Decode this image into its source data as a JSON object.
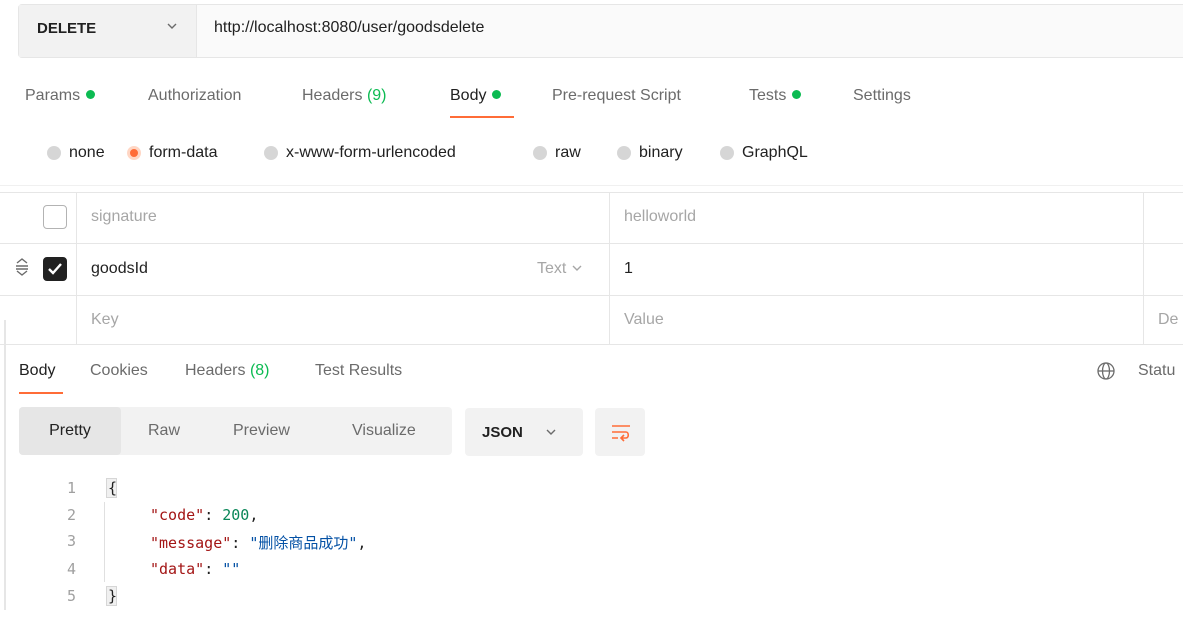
{
  "request": {
    "method": "DELETE",
    "url": "http://localhost:8080/user/goodsdelete"
  },
  "request_tabs": {
    "params": "Params",
    "authorization": "Authorization",
    "headers": "Headers",
    "headers_count": "(9)",
    "body": "Body",
    "pre_request_script": "Pre-request Script",
    "tests": "Tests",
    "settings": "Settings"
  },
  "body_types": {
    "none": "none",
    "form_data": "form-data",
    "urlencoded": "x-www-form-urlencoded",
    "raw": "raw",
    "binary": "binary",
    "graphql": "GraphQL",
    "selected": "form-data"
  },
  "params_rows": [
    {
      "key": "signature",
      "value": "helloworld",
      "checked": false
    },
    {
      "key": "goodsId",
      "type": "Text",
      "value": "1",
      "checked": true
    }
  ],
  "params_placeholders": {
    "key": "Key",
    "value": "Value",
    "description": "De"
  },
  "response_tabs": {
    "body": "Body",
    "cookies": "Cookies",
    "headers": "Headers",
    "headers_count": "(8)",
    "test_results": "Test Results",
    "status": "Statu"
  },
  "format_bar": {
    "pretty": "Pretty",
    "raw": "Raw",
    "preview": "Preview",
    "visualize": "Visualize",
    "language": "JSON"
  },
  "response_body": {
    "line_numbers": [
      "1",
      "2",
      "3",
      "4",
      "5"
    ],
    "open_brace": "{",
    "close_brace": "}",
    "code_key": "\"code\"",
    "code_value": "200",
    "message_key": "\"message\"",
    "message_value": "\"删除商品成功\"",
    "data_key": "\"data\"",
    "data_value": "\"\""
  },
  "colors": {
    "accent": "#ff6c37",
    "green": "#0cbb52",
    "json_key": "#a31515",
    "json_number": "#098658",
    "json_string": "#0451a5"
  }
}
